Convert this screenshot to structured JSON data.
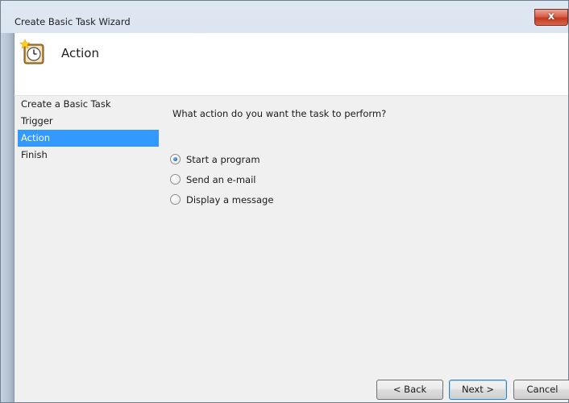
{
  "window": {
    "title": "Create Basic Task Wizard",
    "close_glyph": "x"
  },
  "header": {
    "title": "Action",
    "icon": "task-scheduler-clock-icon"
  },
  "steps": [
    {
      "label": "Create a Basic Task",
      "active": false
    },
    {
      "label": "Trigger",
      "active": false
    },
    {
      "label": "Action",
      "active": true
    },
    {
      "label": "Finish",
      "active": false
    }
  ],
  "prompt": "What action do you want the task to perform?",
  "options": [
    {
      "label": "Start a program",
      "checked": true
    },
    {
      "label": "Send an e-mail",
      "checked": false
    },
    {
      "label": "Display a message",
      "checked": false
    }
  ],
  "buttons": {
    "back": "< Back",
    "next": "Next >",
    "cancel": "Cancel"
  },
  "colors": {
    "selection": "#3399ff",
    "content_bg": "#f0f0f0",
    "close_button": "#c23a22"
  }
}
